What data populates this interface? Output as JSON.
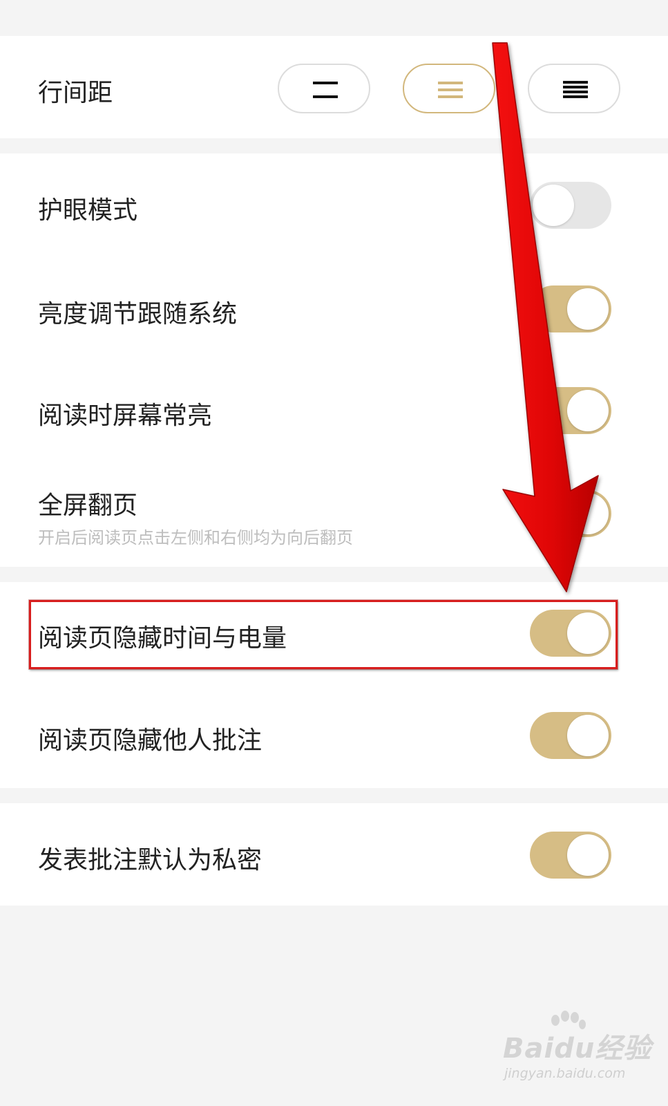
{
  "line_spacing": {
    "label": "行间距",
    "options": [
      {
        "icon": "line-spacing-small-icon",
        "selected": false
      },
      {
        "icon": "line-spacing-medium-icon",
        "selected": true
      },
      {
        "icon": "line-spacing-large-icon",
        "selected": false
      }
    ]
  },
  "display_settings": {
    "eye_care_mode": {
      "label": "护眼模式",
      "enabled": false
    },
    "brightness_follow_system": {
      "label": "亮度调节跟随系统",
      "enabled": true
    },
    "keep_screen_on": {
      "label": "阅读时屏幕常亮",
      "enabled": true
    },
    "fullscreen_page_turn": {
      "label": "全屏翻页",
      "description": "开启后阅读页点击左侧和右侧均为向后翻页",
      "enabled": true
    }
  },
  "reading_page_settings": {
    "hide_time_battery": {
      "label": "阅读页隐藏时间与电量",
      "enabled": true
    },
    "hide_others_notes": {
      "label": "阅读页隐藏他人批注",
      "enabled": true
    }
  },
  "annotation_settings": {
    "private_by_default": {
      "label": "发表批注默认为私密",
      "enabled": true
    }
  },
  "colors": {
    "toggle_on": "#d6bd85",
    "toggle_off": "#e6e6e6",
    "selected_outline": "#d2b77c",
    "annotation_red": "#e01010"
  },
  "watermark": {
    "brand": "Baidu经验",
    "url": "jingyan.baidu.com"
  }
}
